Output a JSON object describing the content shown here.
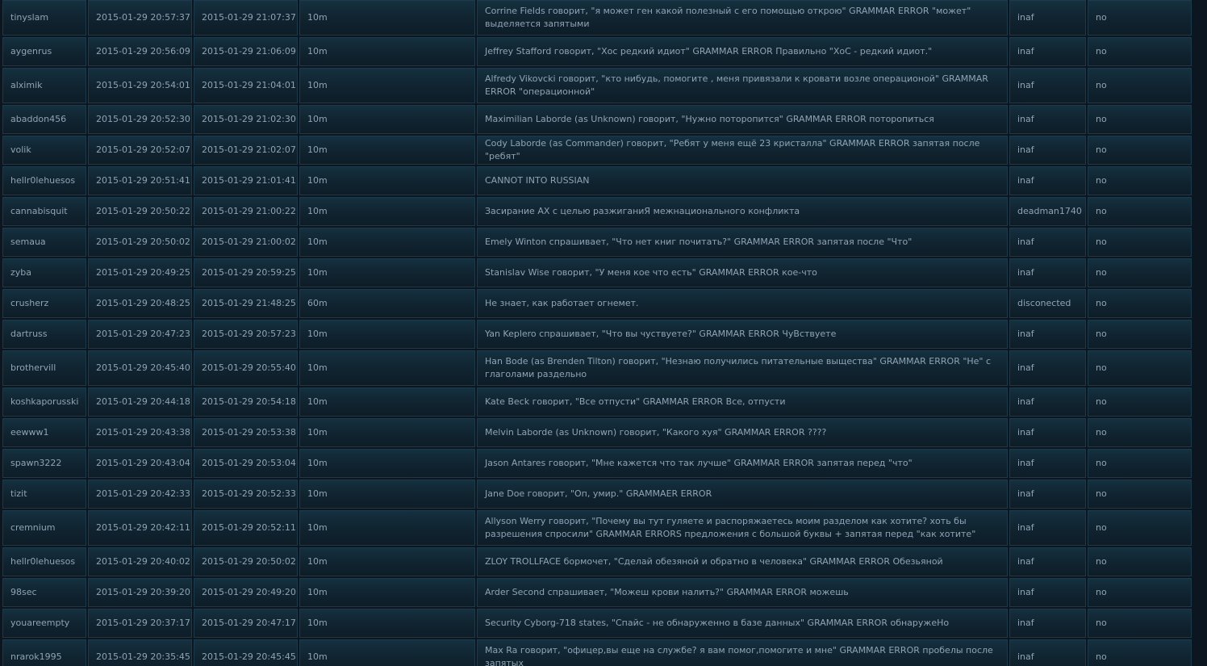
{
  "rows": [
    {
      "ckey": "tinyslam",
      "date": "2015-01-29 20:57:37",
      "expires": "2015-01-29 21:07:37",
      "duration": "10m",
      "reason": "Corrine Fields говорит, \"я может ген какой полезный с его помощью открою\" GRAMMAR ERROR \"может\" выделяется запятыми",
      "admin": "inaf",
      "unbanned": "no",
      "tall": true
    },
    {
      "ckey": "aygenrus",
      "date": "2015-01-29 20:56:09",
      "expires": "2015-01-29 21:06:09",
      "duration": "10m",
      "reason": "Jeffrey Stafford говорит, \"Хос редкий идиот\" GRAMMAR ERROR Правильно \"ХоС - редкий идиот.\"",
      "admin": "inaf",
      "unbanned": "no",
      "tall": false
    },
    {
      "ckey": "alximik",
      "date": "2015-01-29 20:54:01",
      "expires": "2015-01-29 21:04:01",
      "duration": "10m",
      "reason": "Alfredy Vikovcki говорит, \"кто нибудь, помогите , меня привязали к кровати возле операционой\" GRAMMAR ERROR \"операционной\"",
      "admin": "inaf",
      "unbanned": "no",
      "tall": true
    },
    {
      "ckey": "abaddon456",
      "date": "2015-01-29 20:52:30",
      "expires": "2015-01-29 21:02:30",
      "duration": "10m",
      "reason": "Maximilian Laborde (as Unknown) говорит, \"Нужно поторопится\" GRAMMAR ERROR поторопиться",
      "admin": "inaf",
      "unbanned": "no",
      "tall": false
    },
    {
      "ckey": "volik",
      "date": "2015-01-29 20:52:07",
      "expires": "2015-01-29 21:02:07",
      "duration": "10m",
      "reason": "Cody Laborde (as Commander) говорит, \"Ребят у меня ещё 23 кристалла\" GRAMMAR ERROR запятая после \"ребят\"",
      "admin": "inaf",
      "unbanned": "no",
      "tall": false
    },
    {
      "ckey": "hellr0lehuesos",
      "date": "2015-01-29 20:51:41",
      "expires": "2015-01-29 21:01:41",
      "duration": "10m",
      "reason": "CANNOT INTO RUSSIAN",
      "admin": "inaf",
      "unbanned": "no",
      "tall": false
    },
    {
      "ckey": "cannabisquit",
      "date": "2015-01-29 20:50:22",
      "expires": "2015-01-29 21:00:22",
      "duration": "10m",
      "reason": "Засирание АХ с целью разжиганиЯ межнационального конфликта",
      "admin": "deadman1740",
      "unbanned": "no",
      "tall": false
    },
    {
      "ckey": "semaua",
      "date": "2015-01-29 20:50:02",
      "expires": "2015-01-29 21:00:02",
      "duration": "10m",
      "reason": "Emely Winton спрашивает, \"Что нет книг почитать?\" GRAMMAR ERROR запятая после \"Что\"",
      "admin": "inaf",
      "unbanned": "no",
      "tall": false
    },
    {
      "ckey": "zyba",
      "date": "2015-01-29 20:49:25",
      "expires": "2015-01-29 20:59:25",
      "duration": "10m",
      "reason": "Stanislav Wise говорит, \"У меня кое что есть\" GRAMMAR ERROR кое-что",
      "admin": "inaf",
      "unbanned": "no",
      "tall": false
    },
    {
      "ckey": "crusherz",
      "date": "2015-01-29 20:48:25",
      "expires": "2015-01-29 21:48:25",
      "duration": "60m",
      "reason": "Не знает, как работает огнемет.",
      "admin": "disconected",
      "unbanned": "no",
      "tall": false
    },
    {
      "ckey": "dartruss",
      "date": "2015-01-29 20:47:23",
      "expires": "2015-01-29 20:57:23",
      "duration": "10m",
      "reason": "Yan Keplero спрашивает, \"Что вы чуствуете?\" GRAMMAR ERROR ЧуВствуете",
      "admin": "inaf",
      "unbanned": "no",
      "tall": false
    },
    {
      "ckey": "brothervill",
      "date": "2015-01-29 20:45:40",
      "expires": "2015-01-29 20:55:40",
      "duration": "10m",
      "reason": "Han Bode (as Brenden Tilton) говорит, \"Незнаю получились питательные выщества\" GRAMMAR ERROR \"Не\" с глаголами раздельно",
      "admin": "inaf",
      "unbanned": "no",
      "tall": true
    },
    {
      "ckey": "koshkaporusski",
      "date": "2015-01-29 20:44:18",
      "expires": "2015-01-29 20:54:18",
      "duration": "10m",
      "reason": "Kate Beck говорит, \"Все отпусти\" GRAMMAR ERROR Все, отпусти",
      "admin": "inaf",
      "unbanned": "no",
      "tall": false
    },
    {
      "ckey": "eewww1",
      "date": "2015-01-29 20:43:38",
      "expires": "2015-01-29 20:53:38",
      "duration": "10m",
      "reason": "Melvin Laborde (as Unknown) говорит, \"Какого хуя\" GRAMMAR ERROR ????",
      "admin": "inaf",
      "unbanned": "no",
      "tall": false
    },
    {
      "ckey": "spawn3222",
      "date": "2015-01-29 20:43:04",
      "expires": "2015-01-29 20:53:04",
      "duration": "10m",
      "reason": "Jason Antares говорит, \"Мне кажется что так лучше\" GRAMMAR ERROR запятая перед \"что\"",
      "admin": "inaf",
      "unbanned": "no",
      "tall": false
    },
    {
      "ckey": "tizit",
      "date": "2015-01-29 20:42:33",
      "expires": "2015-01-29 20:52:33",
      "duration": "10m",
      "reason": "Jane Doe говорит, \"Оп, умир.\" GRAMMAER ERROR",
      "admin": "inaf",
      "unbanned": "no",
      "tall": false
    },
    {
      "ckey": "cremnium",
      "date": "2015-01-29 20:42:11",
      "expires": "2015-01-29 20:52:11",
      "duration": "10m",
      "reason": "Allyson Werry говорит, \"Почему вы тут гуляете и распоряжаетесь моим разделом как хотите? хоть бы разрешения спросили\" GRAMMAR ERRORS предложения с большой буквы + запятая перед \"как хотите\"",
      "admin": "inaf",
      "unbanned": "no",
      "tall": true
    },
    {
      "ckey": "hellr0lehuesos",
      "date": "2015-01-29 20:40:02",
      "expires": "2015-01-29 20:50:02",
      "duration": "10m",
      "reason": "ZLOY TROLLFACE бормочет, \"Сделай обезяной и обратно в человека\" GRAMMAR ERROR Обезьяной",
      "admin": "inaf",
      "unbanned": "no",
      "tall": false
    },
    {
      "ckey": "98sec",
      "date": "2015-01-29 20:39:20",
      "expires": "2015-01-29 20:49:20",
      "duration": "10m",
      "reason": "Arder Second спрашивает, \"Можеш крови налить?\" GRAMMAR ERROR можешь",
      "admin": "inaf",
      "unbanned": "no",
      "tall": false
    },
    {
      "ckey": "youareempty",
      "date": "2015-01-29 20:37:17",
      "expires": "2015-01-29 20:47:17",
      "duration": "10m",
      "reason": "Security Cyborg-718 states, \"Спайс - не обнаруженно в базе данных\" GRAMMAR ERROR обнаружеНо",
      "admin": "inaf",
      "unbanned": "no",
      "tall": false
    },
    {
      "ckey": "nrarok1995",
      "date": "2015-01-29 20:35:45",
      "expires": "2015-01-29 20:45:45",
      "duration": "10m",
      "reason": "Max Ra говорит, \"офицер,вы еще на службе? я вам помог,помогите и мне\" GRAMMAR ERROR пробелы после запятых",
      "admin": "inaf",
      "unbanned": "no",
      "tall": true
    }
  ]
}
